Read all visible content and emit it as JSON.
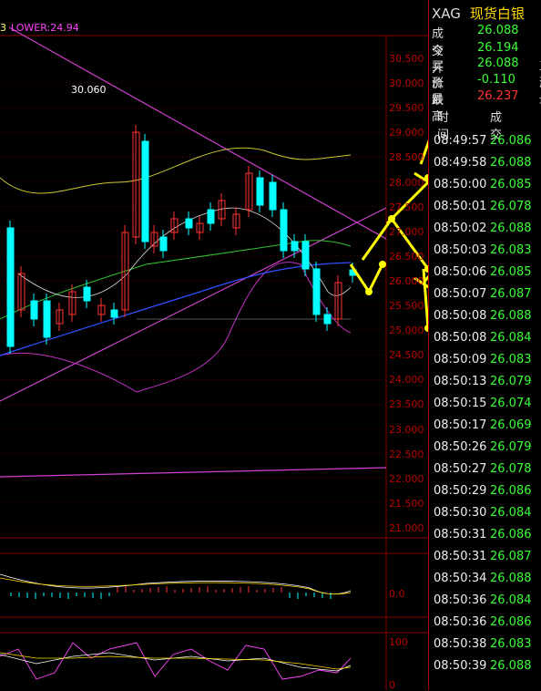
{
  "indicator_legend": {
    "prefix": "3",
    "lower": "LOWER:24.94"
  },
  "chart_labels": {
    "peak": "30.060"
  },
  "price_axis": [
    "30.500",
    "30.000",
    "29.500",
    "29.000",
    "28.500",
    "28.000",
    "27.500",
    "27.000",
    "26.500",
    "26.000",
    "25.500",
    "25.000",
    "24.500",
    "24.000",
    "23.500",
    "23.000",
    "22.500",
    "22.000",
    "21.500",
    "21.000"
  ],
  "macd_axis": [
    "0.0"
  ],
  "kdj_axis": [
    "100",
    "0"
  ],
  "quote": {
    "code": "XAG",
    "name": "现货白银",
    "rows": [
      {
        "label": "成交",
        "value": "26.088",
        "color": "#39ff39",
        "edge": ""
      },
      {
        "label": "今开",
        "value": "26.194",
        "color": "#39ff39",
        "edge": "目"
      },
      {
        "label": "买价",
        "value": "26.088",
        "color": "#39ff39",
        "edge": "三"
      },
      {
        "label": "涨跌",
        "value": "-0.110",
        "color": "#39ff39",
        "edge": "涨"
      },
      {
        "label": "最高",
        "value": "26.237",
        "color": "#ff3333",
        "edge": "最"
      }
    ]
  },
  "ticks_header": {
    "time": "时间",
    "price": "成交"
  },
  "ticks": [
    {
      "time": "08:49:57",
      "price": "26.086"
    },
    {
      "time": "08:49:58",
      "price": "26.088"
    },
    {
      "time": "08:50:00",
      "price": "26.085"
    },
    {
      "time": "08:50:01",
      "price": "26.078"
    },
    {
      "time": "08:50:02",
      "price": "26.088"
    },
    {
      "time": "08:50:03",
      "price": "26.083"
    },
    {
      "time": "08:50:06",
      "price": "26.085"
    },
    {
      "time": "08:50:07",
      "price": "26.087"
    },
    {
      "time": "08:50:08",
      "price": "26.088"
    },
    {
      "time": "08:50:08",
      "price": "26.084"
    },
    {
      "time": "08:50:09",
      "price": "26.083"
    },
    {
      "time": "08:50:13",
      "price": "26.079"
    },
    {
      "time": "08:50:15",
      "price": "26.074"
    },
    {
      "time": "08:50:17",
      "price": "26.069"
    },
    {
      "time": "08:50:26",
      "price": "26.079"
    },
    {
      "time": "08:50:27",
      "price": "26.078"
    },
    {
      "time": "08:50:29",
      "price": "26.086"
    },
    {
      "time": "08:50:30",
      "price": "26.084"
    },
    {
      "time": "08:50:31",
      "price": "26.086"
    },
    {
      "time": "08:50:31",
      "price": "26.087"
    },
    {
      "time": "08:50:34",
      "price": "26.088"
    },
    {
      "time": "08:50:36",
      "price": "26.084"
    },
    {
      "time": "08:50:36",
      "price": "26.086"
    },
    {
      "time": "08:50:38",
      "price": "26.083"
    },
    {
      "time": "08:50:39",
      "price": "26.088"
    }
  ],
  "colors": {
    "up": "#ff3333",
    "down": "#00ffff",
    "grid": "#8b0000",
    "tick_price": "#39ff39",
    "annotation": "#ffff00"
  }
}
